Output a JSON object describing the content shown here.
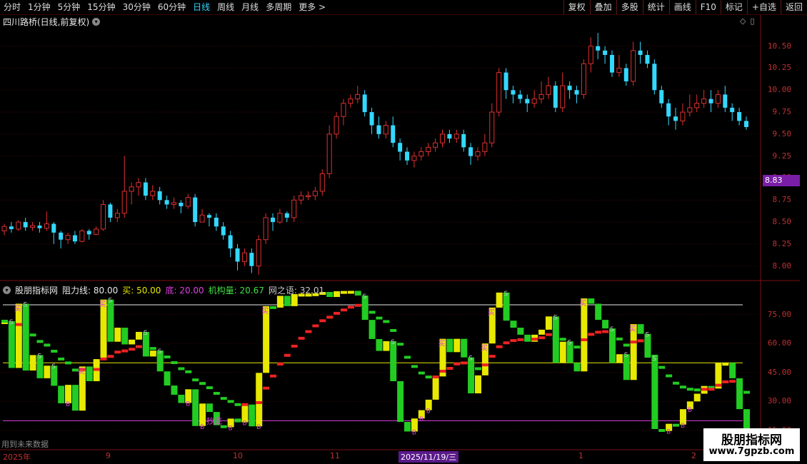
{
  "toolbar": {
    "periods": [
      "分时",
      "1分钟",
      "5分钟",
      "15分钟",
      "30分钟",
      "60分钟",
      "日线",
      "周线",
      "月线",
      "多周期",
      "更多 >"
    ],
    "active_period": "日线",
    "right_buttons": [
      "复权",
      "叠加",
      "多股",
      "统计",
      "画线",
      "F10",
      "标记",
      "+自选",
      "返回"
    ]
  },
  "main_title": "四川路桥(日线,前复权)",
  "price_axis": [
    "10.50",
    "10.25",
    "10.00",
    "9.75",
    "9.50",
    "9.25",
    "9.00",
    "8.75",
    "8.50",
    "8.25",
    "8.00"
  ],
  "price_tag": "8.83",
  "indicator": {
    "name": "股朋指标网",
    "items": [
      {
        "label": "阻力线: 80.00",
        "color": "#e8e8e8"
      },
      {
        "label": "买: 50.00",
        "color": "#e8e800"
      },
      {
        "label": "底: 20.00",
        "color": "#e040e0"
      },
      {
        "label": "机构量: 20.67",
        "color": "#40e040"
      },
      {
        "label": "网之语: 32.01",
        "color": "#c8c8c8"
      }
    ],
    "axis": [
      "75.00",
      "60.00",
      "45.00",
      "30.00",
      "15.00"
    ]
  },
  "bottom_note": "用到未来数据",
  "date_axis": [
    "2025年",
    "9",
    "10",
    "11",
    "2025/11/19/三",
    "1",
    "2"
  ],
  "watermark": {
    "line1": "股朋指标网",
    "line2": "www.7gpzb.com"
  },
  "markers": {
    "buy": "买",
    "bottom": "抄底",
    "s": "S",
    "b": "B"
  },
  "colors": {
    "up": "#e03030",
    "down": "#33d8ff",
    "yellow": "#e8e800",
    "green": "#22cc22",
    "red": "#ee2222",
    "magenta": "#e040e0",
    "white": "#e8e8e8"
  },
  "chart_data": {
    "type": "candlestick",
    "ylim": [
      7.9,
      10.7
    ],
    "candles": [
      [
        8.4,
        8.45,
        8.35,
        8.48
      ],
      [
        8.45,
        8.42,
        8.38,
        8.5
      ],
      [
        8.42,
        8.5,
        8.4,
        8.52
      ],
      [
        8.5,
        8.44,
        8.4,
        8.55
      ],
      [
        8.44,
        8.46,
        8.4,
        8.5
      ],
      [
        8.46,
        8.43,
        8.38,
        8.5
      ],
      [
        8.43,
        8.48,
        8.4,
        8.62
      ],
      [
        8.48,
        8.38,
        8.25,
        8.5
      ],
      [
        8.38,
        8.3,
        8.2,
        8.4
      ],
      [
        8.3,
        8.35,
        8.25,
        8.38
      ],
      [
        8.35,
        8.28,
        8.25,
        8.4
      ],
      [
        8.28,
        8.4,
        8.27,
        8.42
      ],
      [
        8.4,
        8.36,
        8.3,
        8.42
      ],
      [
        8.36,
        8.42,
        8.35,
        8.45
      ],
      [
        8.42,
        8.7,
        8.4,
        8.75
      ],
      [
        8.7,
        8.55,
        8.5,
        8.72
      ],
      [
        8.55,
        8.6,
        8.5,
        8.65
      ],
      [
        8.6,
        8.85,
        8.55,
        9.25
      ],
      [
        8.85,
        8.9,
        8.7,
        8.95
      ],
      [
        8.9,
        8.95,
        8.8,
        9.0
      ],
      [
        8.95,
        8.8,
        8.75,
        9.0
      ],
      [
        8.8,
        8.85,
        8.75,
        8.92
      ],
      [
        8.85,
        8.75,
        8.7,
        8.9
      ],
      [
        8.75,
        8.7,
        8.65,
        8.8
      ],
      [
        8.7,
        8.72,
        8.65,
        8.78
      ],
      [
        8.72,
        8.68,
        8.6,
        8.75
      ],
      [
        8.68,
        8.78,
        8.65,
        8.82
      ],
      [
        8.78,
        8.5,
        8.45,
        8.82
      ],
      [
        8.5,
        8.58,
        8.5,
        8.65
      ],
      [
        8.58,
        8.55,
        8.45,
        8.6
      ],
      [
        8.55,
        8.45,
        8.4,
        8.6
      ],
      [
        8.45,
        8.35,
        8.3,
        8.5
      ],
      [
        8.35,
        8.2,
        8.1,
        8.4
      ],
      [
        8.2,
        8.05,
        7.95,
        8.25
      ],
      [
        8.05,
        8.15,
        8.0,
        8.2
      ],
      [
        8.15,
        8.0,
        7.92,
        8.2
      ],
      [
        8.0,
        8.3,
        7.9,
        8.35
      ],
      [
        8.3,
        8.55,
        8.25,
        8.6
      ],
      [
        8.55,
        8.5,
        8.4,
        8.6
      ],
      [
        8.5,
        8.6,
        8.48,
        8.65
      ],
      [
        8.6,
        8.55,
        8.5,
        8.62
      ],
      [
        8.55,
        8.75,
        8.5,
        8.8
      ],
      [
        8.75,
        8.8,
        8.7,
        8.85
      ],
      [
        8.8,
        8.8,
        8.75,
        8.85
      ],
      [
        8.8,
        8.85,
        8.75,
        8.9
      ],
      [
        8.85,
        9.05,
        8.8,
        9.1
      ],
      [
        9.05,
        9.5,
        9.0,
        9.6
      ],
      [
        9.5,
        9.7,
        9.45,
        9.75
      ],
      [
        9.7,
        9.85,
        9.6,
        9.9
      ],
      [
        9.85,
        9.9,
        9.8,
        9.95
      ],
      [
        9.9,
        9.95,
        9.85,
        10.05
      ],
      [
        9.95,
        9.75,
        9.7,
        10.0
      ],
      [
        9.75,
        9.6,
        9.5,
        9.8
      ],
      [
        9.6,
        9.5,
        9.45,
        9.7
      ],
      [
        9.5,
        9.6,
        9.45,
        9.65
      ],
      [
        9.6,
        9.4,
        9.35,
        9.7
      ],
      [
        9.4,
        9.3,
        9.2,
        9.45
      ],
      [
        9.3,
        9.2,
        9.15,
        9.35
      ],
      [
        9.2,
        9.25,
        9.12,
        9.3
      ],
      [
        9.25,
        9.3,
        9.2,
        9.35
      ],
      [
        9.3,
        9.35,
        9.25,
        9.4
      ],
      [
        9.35,
        9.4,
        9.3,
        9.45
      ],
      [
        9.4,
        9.5,
        9.35,
        9.55
      ],
      [
        9.5,
        9.45,
        9.4,
        9.55
      ],
      [
        9.45,
        9.5,
        9.4,
        9.55
      ],
      [
        9.5,
        9.35,
        9.3,
        9.55
      ],
      [
        9.35,
        9.25,
        9.15,
        9.4
      ],
      [
        9.25,
        9.3,
        9.2,
        9.35
      ],
      [
        9.3,
        9.4,
        9.25,
        9.5
      ],
      [
        9.4,
        9.75,
        9.35,
        9.85
      ],
      [
        9.75,
        10.2,
        9.7,
        10.25
      ],
      [
        10.2,
        10.0,
        9.9,
        10.25
      ],
      [
        10.0,
        9.95,
        9.85,
        10.05
      ],
      [
        9.95,
        9.9,
        9.85,
        10.0
      ],
      [
        9.9,
        9.85,
        9.75,
        9.95
      ],
      [
        9.85,
        9.9,
        9.8,
        10.0
      ],
      [
        9.9,
        9.95,
        9.85,
        10.1
      ],
      [
        9.95,
        10.05,
        9.9,
        10.15
      ],
      [
        10.05,
        9.8,
        9.75,
        10.1
      ],
      [
        9.8,
        10.05,
        9.75,
        10.2
      ],
      [
        10.05,
        10.0,
        9.9,
        10.1
      ],
      [
        10.0,
        9.95,
        9.85,
        10.05
      ],
      [
        9.95,
        10.3,
        9.9,
        10.35
      ],
      [
        10.3,
        10.5,
        10.2,
        10.6
      ],
      [
        10.5,
        10.45,
        10.35,
        10.65
      ],
      [
        10.45,
        10.4,
        10.3,
        10.5
      ],
      [
        10.4,
        10.2,
        10.15,
        10.45
      ],
      [
        10.2,
        10.25,
        10.15,
        10.4
      ],
      [
        10.25,
        10.1,
        10.05,
        10.3
      ],
      [
        10.1,
        10.45,
        10.05,
        10.55
      ],
      [
        10.45,
        10.4,
        10.3,
        10.55
      ],
      [
        10.4,
        10.3,
        10.25,
        10.45
      ],
      [
        10.3,
        10.0,
        9.95,
        10.35
      ],
      [
        10.0,
        9.85,
        9.8,
        10.05
      ],
      [
        9.85,
        9.7,
        9.6,
        9.9
      ],
      [
        9.7,
        9.65,
        9.55,
        9.8
      ],
      [
        9.65,
        9.75,
        9.6,
        9.85
      ],
      [
        9.75,
        9.8,
        9.7,
        9.95
      ],
      [
        9.8,
        9.85,
        9.75,
        9.95
      ],
      [
        9.85,
        9.9,
        9.8,
        10.0
      ],
      [
        9.9,
        9.85,
        9.75,
        10.0
      ],
      [
        9.85,
        9.95,
        9.8,
        10.0
      ],
      [
        9.95,
        9.8,
        9.75,
        10.05
      ],
      [
        9.8,
        9.75,
        9.65,
        9.85
      ],
      [
        9.75,
        9.65,
        9.6,
        9.8
      ],
      [
        9.65,
        9.58,
        9.55,
        9.7
      ]
    ],
    "indicator_lines": {
      "resistance": 80,
      "buy": 50,
      "bottom": 20
    }
  }
}
